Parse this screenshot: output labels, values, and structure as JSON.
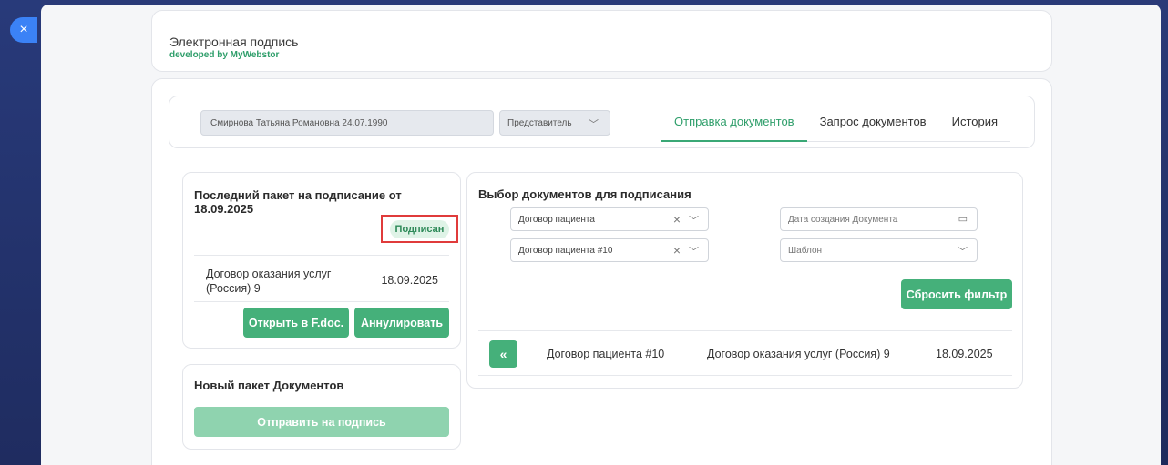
{
  "modal": {
    "close_icon": "×"
  },
  "header": {
    "title": "Электронная подпись",
    "subtitle": "developed by MyWebstor"
  },
  "topbar": {
    "patient": "Смирнова Татьяна Романовна 24.07.1990",
    "role": "Представитель",
    "tabs": [
      {
        "label": "Отправка документов",
        "active": true
      },
      {
        "label": "Запрос документов",
        "active": false
      },
      {
        "label": "История",
        "active": false
      }
    ]
  },
  "last_package": {
    "title": "Последний пакет на подписание от 18.09.2025",
    "status": "Подписан",
    "doc_name": "Договор оказания услуг (Россия) 9",
    "doc_date": "18.09.2025",
    "open_label": "Открыть в F.doc.",
    "cancel_label": "Аннулировать"
  },
  "new_package": {
    "title": "Новый пакет Документов",
    "send_label": "Отправить на подпись"
  },
  "selection": {
    "title": "Выбор документов для подписания",
    "filter1_value": "Договор пациента",
    "filter2_value": "Договор пациента #10",
    "date_placeholder": "Дата создания Документа",
    "template_placeholder": "Шаблон",
    "reset_label": "Сбросить фильтр",
    "back_icon": "«",
    "row": {
      "contract": "Договор пациента #10",
      "service": "Договор оказания услуг (Россия) 9",
      "date": "18.09.2025"
    }
  },
  "colors": {
    "accent": "#45b07a",
    "accent_text": "#2e9e6a",
    "badge_border": "#e03b3b"
  }
}
